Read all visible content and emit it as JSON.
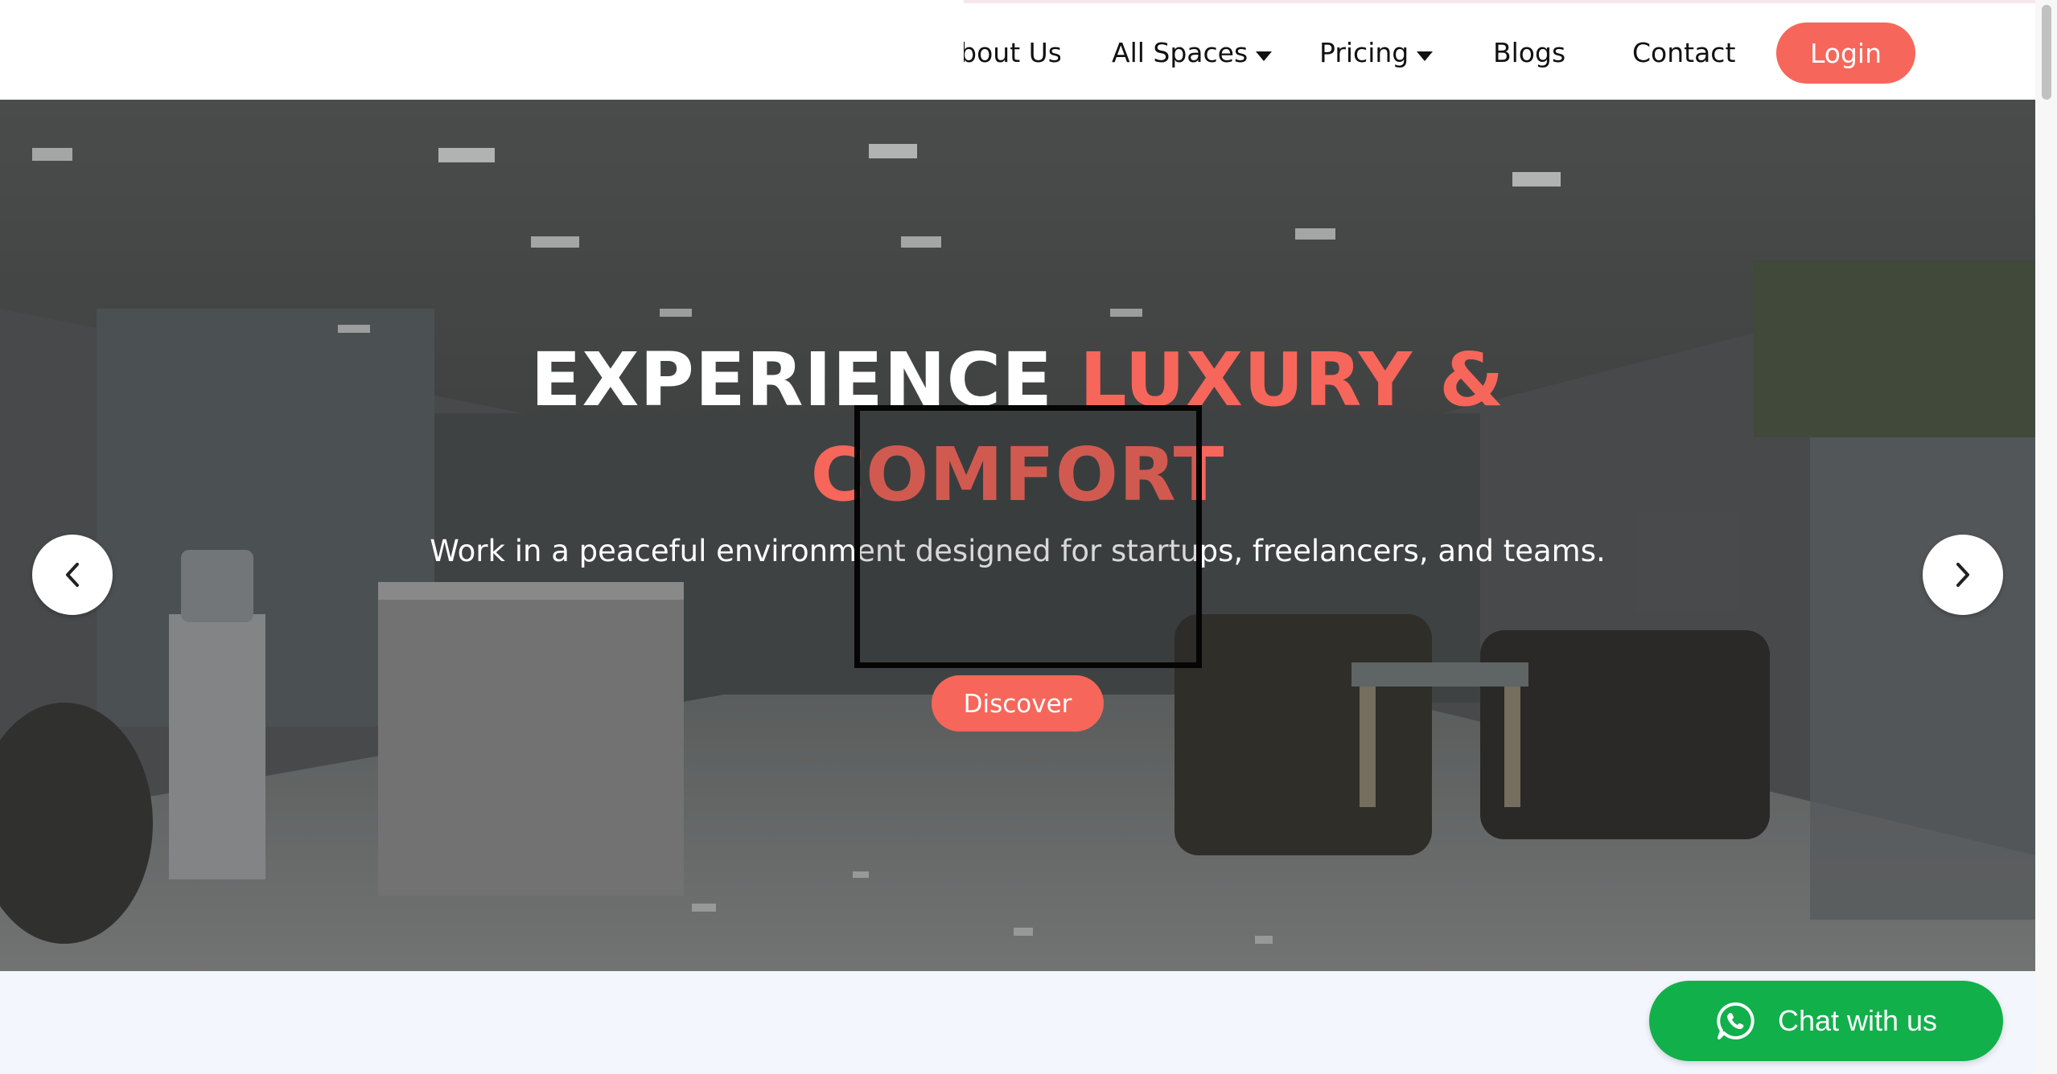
{
  "nav": {
    "about_label": "About Us",
    "all_spaces_label": "All Spaces",
    "pricing_label": "Pricing",
    "blogs_label": "Blogs",
    "contact_label": "Contact",
    "login_label": "Login"
  },
  "hero": {
    "title_white": "EXPERIENCE ",
    "title_accent_line1": "LUXURY &",
    "title_accent_line2": "COMFORT",
    "subtitle": "Work in a peaceful environment designed for startups, freelancers, and teams.",
    "discover_label": "Discover"
  },
  "chat": {
    "label": "Chat with us"
  },
  "colors": {
    "accent": "#f7665a",
    "chat_green": "#11b04b",
    "page_bg": "#f3f6fd"
  },
  "icons": {
    "prev": "chevron-left-icon",
    "next": "chevron-right-icon",
    "chat": "whatsapp-icon",
    "dropdown": "caret-down-icon"
  }
}
